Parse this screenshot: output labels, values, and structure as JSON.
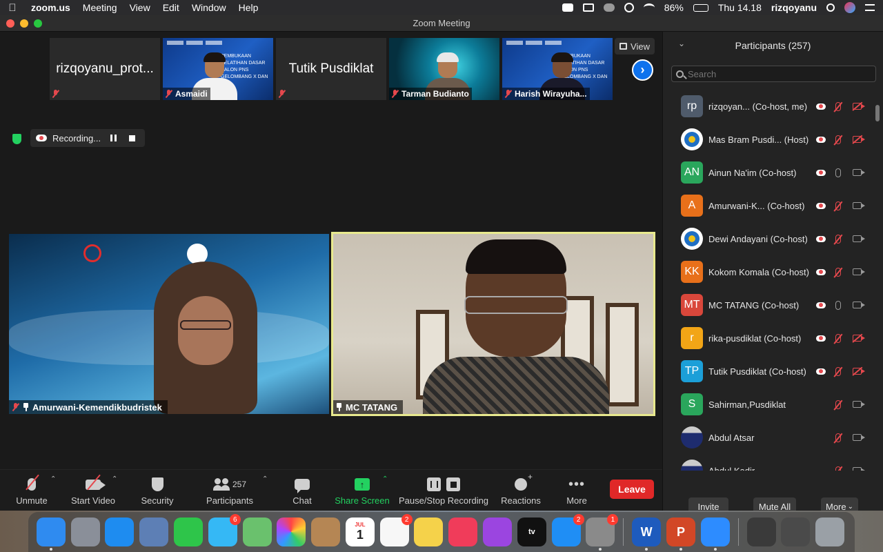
{
  "menubar": {
    "app": "zoom.us",
    "items": [
      "Meeting",
      "View",
      "Edit",
      "Window",
      "Help"
    ],
    "battery": "86%",
    "clock": "Thu 14.18",
    "user": "rizqoyanu"
  },
  "window": {
    "title": "Zoom Meeting"
  },
  "filmstrip": {
    "tiles": [
      {
        "name": "rizqoyanu_prot...",
        "label": "",
        "kind": "name-only"
      },
      {
        "name": "",
        "label": "Asmaidi",
        "kind": "slide"
      },
      {
        "name": "Tutik Pusdiklat",
        "label": "",
        "kind": "name-only"
      },
      {
        "name": "",
        "label": "Tarman Budianto",
        "kind": "tech"
      },
      {
        "name": "",
        "label": "Harish Wirayuha...",
        "kind": "slide"
      }
    ],
    "slide_text": [
      "PEMBUKAAN",
      "PELATIHAN DASAR",
      "CALON PNS",
      "GELOMBANG X DAN XI"
    ],
    "view_label": "View"
  },
  "recording": {
    "label": "Recording..."
  },
  "gallery": {
    "left_name": "Amurwani-Kemendikbudristek",
    "right_name": "MC TATANG"
  },
  "toolbar": {
    "unmute": "Unmute",
    "start_video": "Start Video",
    "security": "Security",
    "participants": "Participants",
    "participants_count": "257",
    "chat": "Chat",
    "share": "Share Screen",
    "record": "Pause/Stop Recording",
    "reactions": "Reactions",
    "more": "More",
    "leave": "Leave"
  },
  "panel": {
    "title": "Participants (257)",
    "search_placeholder": "Search",
    "participants": [
      {
        "initials": "rp",
        "color": "#4f5b6b",
        "name": "rizqoyan...  (Co-host, me)",
        "rec": true,
        "mic": "off",
        "cam": "off"
      },
      {
        "initials": "",
        "color": "logo",
        "name": "Mas Bram Pusdi...  (Host)",
        "rec": true,
        "mic": "off",
        "cam": "off"
      },
      {
        "initials": "AN",
        "color": "#2aa65c",
        "name": "Ainun Na'im (Co-host)",
        "rec": true,
        "mic": "on",
        "cam": "on"
      },
      {
        "initials": "A",
        "color": "#e8701a",
        "name": "Amurwani-K...  (Co-host)",
        "rec": true,
        "mic": "off",
        "cam": "on"
      },
      {
        "initials": "",
        "color": "logo",
        "name": "Dewi Andayani (Co-host)",
        "rec": true,
        "mic": "off",
        "cam": "on"
      },
      {
        "initials": "KK",
        "color": "#e8701a",
        "name": "Kokom Komala  (Co-host)",
        "rec": true,
        "mic": "off",
        "cam": "on"
      },
      {
        "initials": "MT",
        "color": "#d9473b",
        "name": "MC TATANG (Co-host)",
        "rec": true,
        "mic": "on",
        "cam": "on"
      },
      {
        "initials": "r",
        "color": "#f2a516",
        "name": "rika-pusdiklat (Co-host)",
        "rec": true,
        "mic": "off",
        "cam": "off"
      },
      {
        "initials": "TP",
        "color": "#1c9fd8",
        "name": "Tutik Pusdiklat  (Co-host)",
        "rec": true,
        "mic": "off",
        "cam": "off"
      },
      {
        "initials": "S",
        "color": "#2aa65c",
        "name": "Sahirman,Pusdiklat",
        "rec": false,
        "mic": "off",
        "cam": "on"
      },
      {
        "initials": "",
        "color": "photo",
        "name": "Abdul Atsar",
        "rec": false,
        "mic": "off",
        "cam": "on"
      },
      {
        "initials": "",
        "color": "photo",
        "name": "Abdul Kadir",
        "rec": false,
        "mic": "off",
        "cam": "on"
      }
    ],
    "invite": "Invite",
    "mute_all": "Mute All",
    "more": "More"
  },
  "dock": {
    "apps": [
      {
        "name": "finder-icon",
        "color": "#2f8bf0",
        "badge": "",
        "running": true
      },
      {
        "name": "launchpad-icon",
        "color": "#8a8f99",
        "badge": "",
        "running": false
      },
      {
        "name": "safari-icon",
        "color": "#1e8cf0",
        "badge": "",
        "running": false
      },
      {
        "name": "mail-stamp-icon",
        "color": "#5d7fb5",
        "badge": "",
        "running": false
      },
      {
        "name": "facetime-icon",
        "color": "#2ec54a",
        "badge": "",
        "running": false
      },
      {
        "name": "messages-icon",
        "color": "#35b8f5",
        "badge": "6",
        "running": false
      },
      {
        "name": "maps-icon",
        "color": "#6ac16d",
        "badge": "",
        "running": false
      },
      {
        "name": "photos-icon",
        "color": "#f5f5f5",
        "badge": "",
        "running": false
      },
      {
        "name": "contacts-icon",
        "color": "#b58654",
        "badge": "",
        "running": false
      },
      {
        "name": "calendar-icon",
        "color": "#ffffff",
        "badge": "",
        "running": false,
        "text": "1",
        "month": "JUL"
      },
      {
        "name": "reminders-icon",
        "color": "#f7f7f7",
        "badge": "2",
        "running": false
      },
      {
        "name": "notes-icon",
        "color": "#f5d24a",
        "badge": "",
        "running": false
      },
      {
        "name": "music-icon",
        "color": "#f03c5a",
        "badge": "",
        "running": false
      },
      {
        "name": "podcasts-icon",
        "color": "#9b45e0",
        "badge": "",
        "running": false
      },
      {
        "name": "appletv-icon",
        "color": "#111111",
        "badge": "",
        "running": false,
        "text": "tv"
      },
      {
        "name": "appstore-icon",
        "color": "#1f8ef5",
        "badge": "2",
        "running": false
      },
      {
        "name": "system-preferences-icon",
        "color": "#8a8a8a",
        "badge": "1",
        "running": true
      }
    ],
    "apps2": [
      {
        "name": "word-icon",
        "color": "#1e5bbd",
        "badge": "",
        "running": true,
        "text": "W"
      },
      {
        "name": "powerpoint-icon",
        "color": "#d24726",
        "badge": "",
        "running": true,
        "text": "P"
      },
      {
        "name": "zoom-icon",
        "color": "#2d8cff",
        "badge": "",
        "running": true
      }
    ],
    "apps3": [
      {
        "name": "downloads-stack-icon",
        "color": "#3a3a3a",
        "badge": "",
        "running": false
      },
      {
        "name": "screenshots-stack-icon",
        "color": "#4a4a4a",
        "badge": "",
        "running": false
      },
      {
        "name": "trash-icon",
        "color": "#9aa0a6",
        "badge": "",
        "running": false
      }
    ]
  }
}
